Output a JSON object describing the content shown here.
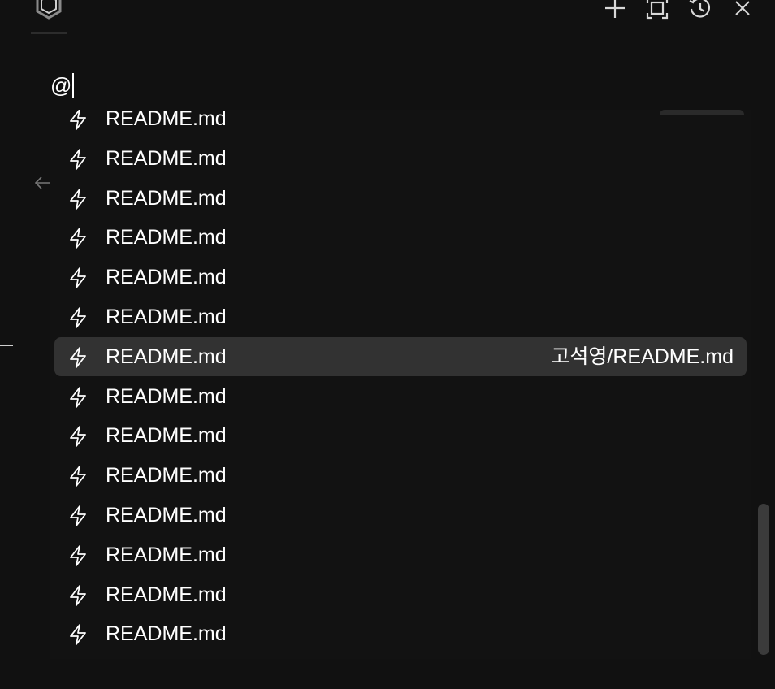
{
  "header": {
    "logo_icon": "hexagon-logo-icon",
    "buttons": [
      {
        "name": "new-button",
        "icon": "plus-icon"
      },
      {
        "name": "expand-button",
        "icon": "maximize-icon"
      },
      {
        "name": "history-button",
        "icon": "history-icon"
      },
      {
        "name": "close-button",
        "icon": "close-icon"
      }
    ]
  },
  "search": {
    "value": "@"
  },
  "mention_list": {
    "item_icon": "bolt-icon",
    "items": [
      {
        "label": "README.md",
        "path": ""
      },
      {
        "label": "README.md",
        "path": ""
      },
      {
        "label": "README.md",
        "path": ""
      },
      {
        "label": "README.md",
        "path": ""
      },
      {
        "label": "README.md",
        "path": ""
      },
      {
        "label": "README.md",
        "path": ""
      },
      {
        "label": "README.md",
        "path": "고석영/README.md",
        "selected": true
      },
      {
        "label": "README.md",
        "path": ""
      },
      {
        "label": "README.md",
        "path": ""
      },
      {
        "label": "README.md",
        "path": ""
      },
      {
        "label": "README.md",
        "path": ""
      },
      {
        "label": "README.md",
        "path": ""
      },
      {
        "label": "README.md",
        "path": ""
      },
      {
        "label": "README.md",
        "path": ""
      }
    ]
  },
  "colors": {
    "background": "#111111",
    "selected_row": "#323232",
    "text": "#ffffff",
    "scrollbar": "#3b3b3b"
  }
}
